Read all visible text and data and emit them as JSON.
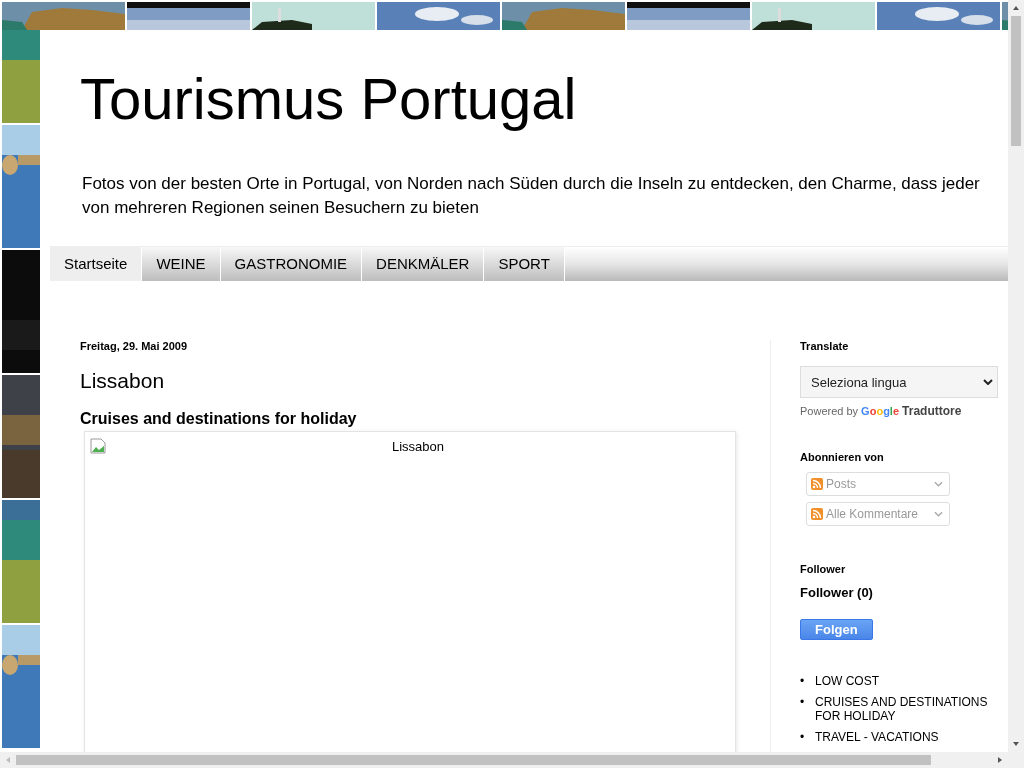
{
  "header": {
    "title": "Tourismus Portugal",
    "description": "Fotos von der besten Orte in Portugal, von Norden nach Süden durch die Inseln zu entdecken, den Charme, dass jeder von mehreren Regionen seinen Besuchern zu bieten"
  },
  "tabs": [
    {
      "label": "Startseite",
      "selected": true
    },
    {
      "label": "WEINE",
      "selected": false
    },
    {
      "label": "GASTRONOMIE",
      "selected": false
    },
    {
      "label": "DENKMÄLER",
      "selected": false
    },
    {
      "label": "SPORT",
      "selected": false
    }
  ],
  "post": {
    "date": "Freitag, 29. Mai 2009",
    "title": "Lissabon",
    "subtitle": "Cruises and destinations for holiday",
    "image_alt": "Lissabon"
  },
  "sidebar": {
    "translate": {
      "heading": "Translate",
      "select": "Seleziona lingua",
      "powered_by": "Powered by",
      "brand": "Google",
      "product": "Traduttore"
    },
    "subscribe": {
      "heading": "Abonnieren von",
      "feeds": [
        "Posts",
        "Alle Kommentare"
      ]
    },
    "follower": {
      "heading": "Follower",
      "count": "Follower (0)",
      "button": "Folgen"
    },
    "link_marker": "•",
    "links": [
      "LOW COST",
      "CRUISES AND DESTINATIONS FOR HOLIDAY",
      "TRAVEL - VACATIONS"
    ]
  }
}
